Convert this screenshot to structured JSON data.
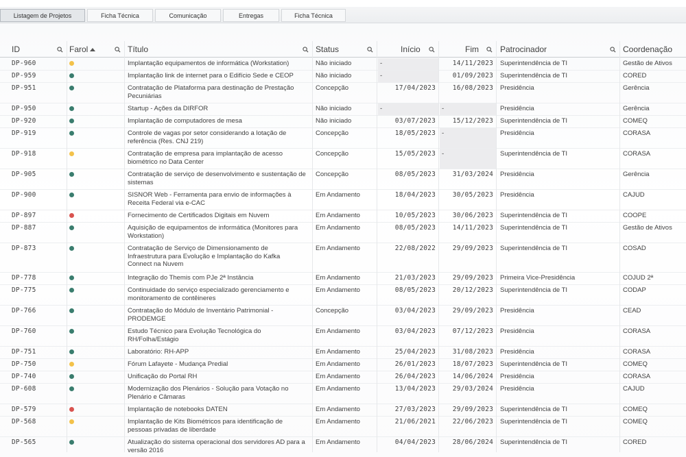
{
  "tabs": [
    {
      "label": "Listagem de Projetos",
      "active": true
    },
    {
      "label": "Ficha Técnica",
      "active": false
    },
    {
      "label": "Comunicação",
      "active": false
    },
    {
      "label": "Entregas",
      "active": false
    },
    {
      "label": "Ficha Técnica",
      "active": false
    }
  ],
  "columns": {
    "id": "ID",
    "farol": "Farol",
    "titulo": "Título",
    "status": "Status",
    "inicio": "Início",
    "fim": "Fim",
    "patrocinador": "Patrocinador",
    "coordenacao": "Coordenação"
  },
  "colors": {
    "green": "#3a7d6e",
    "yellow": "#f3c24a",
    "red": "#d9534f"
  },
  "rows": [
    {
      "id": "DP-960",
      "farol": "yellow",
      "titulo": [
        "Implantação equipamentos de informática (Workstation)"
      ],
      "status": "Não iniciado",
      "inicio": "-",
      "fim": "14/11/2023",
      "patrocinador": "Superintendência de TI",
      "coordenacao": "Gestão de Ativos"
    },
    {
      "id": "DP-959",
      "farol": "green",
      "titulo": [
        "Implantação link de internet para o Edifício Sede e CEOP"
      ],
      "status": "Não iniciado",
      "inicio": "-",
      "fim": "01/09/2023",
      "patrocinador": "Superintendência de TI",
      "coordenacao": "CORED"
    },
    {
      "id": "DP-951",
      "farol": "green",
      "titulo": [
        "Contratação de Plataforma para destinação de Prestação",
        "Pecuniárias"
      ],
      "status": "Concepção",
      "inicio": "17/04/2023",
      "fim": "16/08/2023",
      "patrocinador": "Presidência",
      "coordenacao": "Gerência"
    },
    {
      "id": "DP-950",
      "farol": "green",
      "titulo": [
        "Startup - Ações da DIRFOR"
      ],
      "status": "Não iniciado",
      "inicio": "-",
      "fim": "-",
      "patrocinador": "Presidência",
      "coordenacao": "Gerência"
    },
    {
      "id": "DP-920",
      "farol": "green",
      "titulo": [
        "Implantação de computadores de mesa"
      ],
      "status": "Não iniciado",
      "inicio": "03/07/2023",
      "fim": "15/12/2023",
      "patrocinador": "Superintendência de TI",
      "coordenacao": "COMEQ"
    },
    {
      "id": "DP-919",
      "farol": "green",
      "titulo": [
        "Controle de vagas por setor considerando a lotação de",
        "referência (Res. CNJ 219)"
      ],
      "status": "Concepção",
      "inicio": "18/05/2023",
      "fim": "-",
      "patrocinador": "Presidência",
      "coordenacao": "CORASA"
    },
    {
      "id": "DP-918",
      "farol": "yellow",
      "titulo": [
        "Contratação de empresa para implantação de acesso",
        "biométrico no Data Center"
      ],
      "status": "Concepção",
      "inicio": "15/05/2023",
      "fim": "-",
      "patrocinador": "Superintendência de TI",
      "coordenacao": "CORASA"
    },
    {
      "id": "DP-905",
      "farol": "green",
      "titulo": [
        "Contratação de serviço de desenvolvimento e sustentação de",
        "sistemas"
      ],
      "status": "Concepção",
      "inicio": "08/05/2023",
      "fim": "31/03/2024",
      "patrocinador": "Presidência",
      "coordenacao": "Gerência"
    },
    {
      "id": "DP-900",
      "farol": "green",
      "titulo": [
        "SISNOR Web - Ferramenta para envio de informações à",
        "Receita Federal via e-CAC"
      ],
      "status": "Em Andamento",
      "inicio": "18/04/2023",
      "fim": "30/05/2023",
      "patrocinador": "Presidência",
      "coordenacao": "CAJUD"
    },
    {
      "id": "DP-897",
      "farol": "red",
      "titulo": [
        "Fornecimento de Certificados Digitais em Nuvem"
      ],
      "status": "Em Andamento",
      "inicio": "10/05/2023",
      "fim": "30/06/2023",
      "patrocinador": "Superintendência de TI",
      "coordenacao": "COOPE"
    },
    {
      "id": "DP-887",
      "farol": "green",
      "titulo": [
        "Aquisição de equipamentos de informática (Monitores para",
        "Workstation)"
      ],
      "status": "Em Andamento",
      "inicio": "08/05/2023",
      "fim": "14/11/2023",
      "patrocinador": "Superintendência de TI",
      "coordenacao": "Gestão de Ativos"
    },
    {
      "id": "DP-873",
      "farol": "green",
      "titulo": [
        "Contratação de Serviço de Dimensionamento de",
        "Infraestrutura para Evolução e Implantação do Kafka",
        "Connect na Nuvem"
      ],
      "status": "Em Andamento",
      "inicio": "22/08/2022",
      "fim": "29/09/2023",
      "patrocinador": "Superintendência de TI",
      "coordenacao": "COSAD"
    },
    {
      "id": "DP-778",
      "farol": "green",
      "titulo": [
        "Integração do Themis com PJe 2ª Instância"
      ],
      "status": "Em Andamento",
      "inicio": "21/03/2023",
      "fim": "29/09/2023",
      "patrocinador": "Primeira Vice-Presidência",
      "coordenacao": "COJUD 2ª"
    },
    {
      "id": "DP-775",
      "farol": "green",
      "titulo": [
        "Continuidade do serviço especializado gerenciamento e",
        "monitoramento de contêineres"
      ],
      "status": "Em Andamento",
      "inicio": "08/05/2023",
      "fim": "20/12/2023",
      "patrocinador": "Superintendência de TI",
      "coordenacao": "CODAP"
    },
    {
      "id": "DP-766",
      "farol": "green",
      "titulo": [
        "Contratação do Módulo de Inventário Patrimonial -",
        "PRODEMGE"
      ],
      "status": "Concepção",
      "inicio": "03/04/2023",
      "fim": "29/09/2023",
      "patrocinador": "Presidência",
      "coordenacao": "CEAD"
    },
    {
      "id": "DP-760",
      "farol": "green",
      "titulo": [
        "Estudo Técnico para Evolução Tecnológica do",
        "RH/Folha/Estágio"
      ],
      "status": "Em Andamento",
      "inicio": "03/04/2023",
      "fim": "07/12/2023",
      "patrocinador": "Presidência",
      "coordenacao": "CORASA"
    },
    {
      "id": "DP-751",
      "farol": "green",
      "titulo": [
        "Laboratório: RH-APP"
      ],
      "status": "Em Andamento",
      "inicio": "25/04/2023",
      "fim": "31/08/2023",
      "patrocinador": "Presidência",
      "coordenacao": "CORASA"
    },
    {
      "id": "DP-750",
      "farol": "yellow",
      "titulo": [
        "Fórum Lafayete - Mudança Predial"
      ],
      "status": "Em Andamento",
      "inicio": "26/01/2023",
      "fim": "18/07/2023",
      "patrocinador": "Superintendência de TI",
      "coordenacao": "COMEQ"
    },
    {
      "id": "DP-740",
      "farol": "green",
      "titulo": [
        "Unificação do Portal RH"
      ],
      "status": "Em Andamento",
      "inicio": "26/04/2023",
      "fim": "14/06/2024",
      "patrocinador": "Presidência",
      "coordenacao": "CORASA"
    },
    {
      "id": "DP-608",
      "farol": "green",
      "titulo": [
        "Modernização dos Plenários - Solução para Votação no",
        "Plenário e Câmaras"
      ],
      "status": "Em Andamento",
      "inicio": "13/04/2023",
      "fim": "29/03/2024",
      "patrocinador": "Presidência",
      "coordenacao": "CAJUD"
    },
    {
      "id": "DP-579",
      "farol": "red",
      "titulo": [
        "Implantação de notebooks DATEN"
      ],
      "status": "Em Andamento",
      "inicio": "27/03/2023",
      "fim": "29/09/2023",
      "patrocinador": "Superintendência de TI",
      "coordenacao": "COMEQ"
    },
    {
      "id": "DP-568",
      "farol": "yellow",
      "titulo": [
        "Implantação de Kits Biométricos para identificação de",
        "pessoas privadas de liberdade"
      ],
      "status": "Em Andamento",
      "inicio": "21/06/2021",
      "fim": "22/06/2023",
      "patrocinador": "Superintendência de TI",
      "coordenacao": "COMEQ"
    },
    {
      "id": "DP-565",
      "farol": "green",
      "titulo": [
        "Atualização do sistema operacional dos servidores AD para a",
        "versão 2016"
      ],
      "status": "Em Andamento",
      "inicio": "04/04/2023",
      "fim": "28/06/2024",
      "patrocinador": "Superintendência de TI",
      "coordenacao": "CORED"
    }
  ]
}
